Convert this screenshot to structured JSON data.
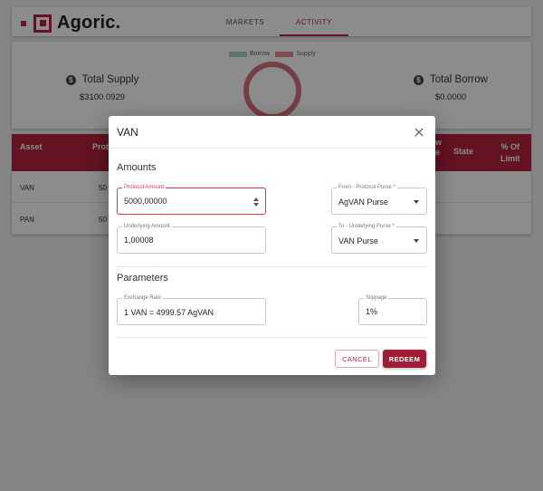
{
  "app": {
    "logo_text": "Agoric.",
    "nav": [
      "MARKETS",
      "ACTIVITY"
    ]
  },
  "summary": {
    "legend": [
      "Borrow",
      "Supply"
    ],
    "legend_colors": [
      "#9fd3c7",
      "#e38b9a"
    ],
    "total_supply_label": "Total Supply",
    "total_supply_value": "$3100.0929",
    "total_borrow_label": "Total Borrow",
    "total_borrow_value": "$0.0000",
    "coin_icon": "$"
  },
  "table": {
    "headers": [
      "Asset",
      "Prot",
      "w\ne",
      "State",
      "% Of\nLimit"
    ],
    "rows": [
      {
        "asset": "VAN",
        "value": "50"
      },
      {
        "asset": "PAN",
        "value": "50"
      }
    ]
  },
  "dialog": {
    "title": "VAN",
    "amounts_title": "Amounts",
    "protocol_amount_label": "Protocol Amount",
    "protocol_amount_value": "5000,00000",
    "from_purse_label": "From - Protocol Purse *",
    "from_purse_value": "AgVAN Purse",
    "underlying_amount_label": "Underlying Amount",
    "underlying_amount_value": "1,00008",
    "to_purse_label": "To - Underlying Purse *",
    "to_purse_value": "VAN Purse",
    "parameters_title": "Parameters",
    "exchange_rate_label": "Exchange Rate",
    "exchange_rate_value": "1 VAN = 4999.57 AgVAN",
    "slippage_label": "Slippage",
    "slippage_value": "1%",
    "cancel_label": "CANCEL",
    "redeem_label": "REDEEM"
  },
  "colors": {
    "brand": "#b5243f",
    "primary_button": "#9f1d36",
    "focus": "#d9364d"
  }
}
